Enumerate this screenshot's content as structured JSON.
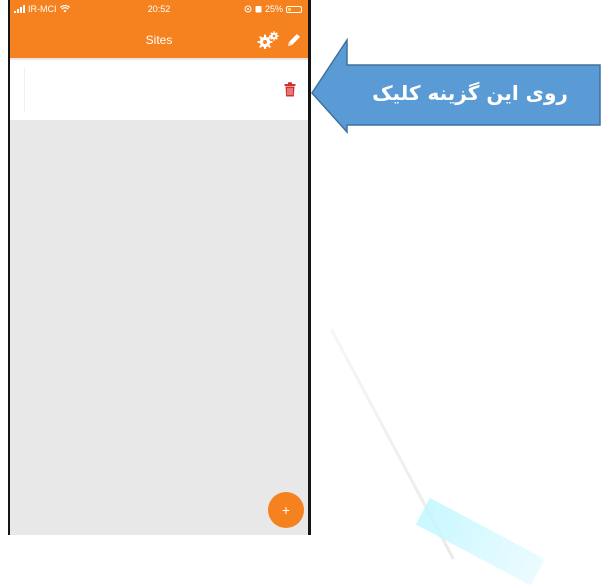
{
  "status_bar": {
    "carrier": "IR-MCI",
    "time": "20:52",
    "battery_percent": "25%",
    "icons": [
      "signal-icon",
      "wifi-icon",
      "location-icon",
      "alarm-icon",
      "battery-icon"
    ]
  },
  "header": {
    "title": "Sites",
    "actions": [
      "settings-gears-icon",
      "edit-pencil-icon"
    ]
  },
  "list": {
    "items": [
      {
        "text": "",
        "action_icon": "trash-icon"
      }
    ]
  },
  "fab": {
    "label": "+"
  },
  "callout": {
    "text": "روی این گزینه کلیک"
  },
  "colors": {
    "accent": "#f5821f",
    "trash": "#d32f2f",
    "callout_fill": "#5b9bd5",
    "callout_stroke": "#41719c",
    "list_bg": "#e8e8e8"
  }
}
